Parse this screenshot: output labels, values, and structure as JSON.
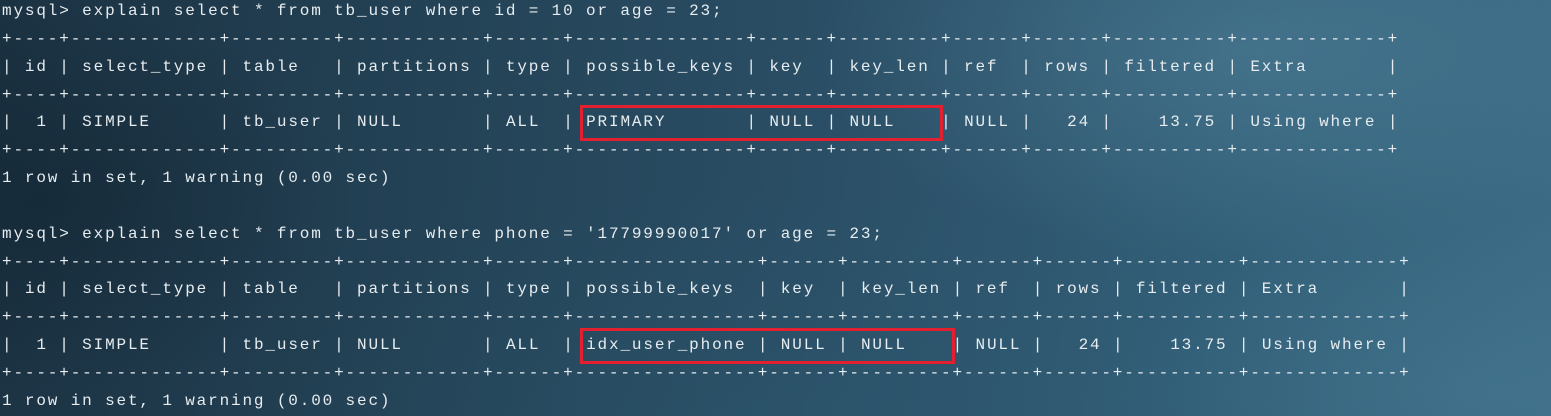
{
  "colors": {
    "text": "#e6ecef",
    "highlight": "#e3202f"
  },
  "terminal": {
    "blocks": [
      {
        "prompt": "mysql>",
        "command": "explain select * from tb_user where id = 10 or age = 23;",
        "columns": [
          "id",
          "select_type",
          "table",
          "partitions",
          "type",
          "possible_keys",
          "key",
          "key_len",
          "ref",
          "rows",
          "filtered",
          "Extra"
        ],
        "rows": [
          [
            "1",
            "SIMPLE",
            "tb_user",
            "NULL",
            "ALL",
            "PRIMARY",
            "NULL",
            "NULL",
            "NULL",
            "24",
            "13.75",
            "Using where"
          ]
        ],
        "status": "1 row in set, 1 warning (0.00 sec)"
      },
      {
        "prompt": "mysql>",
        "command": "explain select * from tb_user where phone = '17799990017' or age = 23;",
        "columns": [
          "id",
          "select_type",
          "table",
          "partitions",
          "type",
          "possible_keys",
          "key",
          "key_len",
          "ref",
          "rows",
          "filtered",
          "Extra"
        ],
        "rows": [
          [
            "1",
            "SIMPLE",
            "tb_user",
            "NULL",
            "ALL",
            "idx_user_phone",
            "NULL",
            "NULL",
            "NULL",
            "24",
            "13.75",
            "Using where"
          ]
        ],
        "status": "1 row in set, 1 warning (0.00 sec)"
      }
    ]
  }
}
